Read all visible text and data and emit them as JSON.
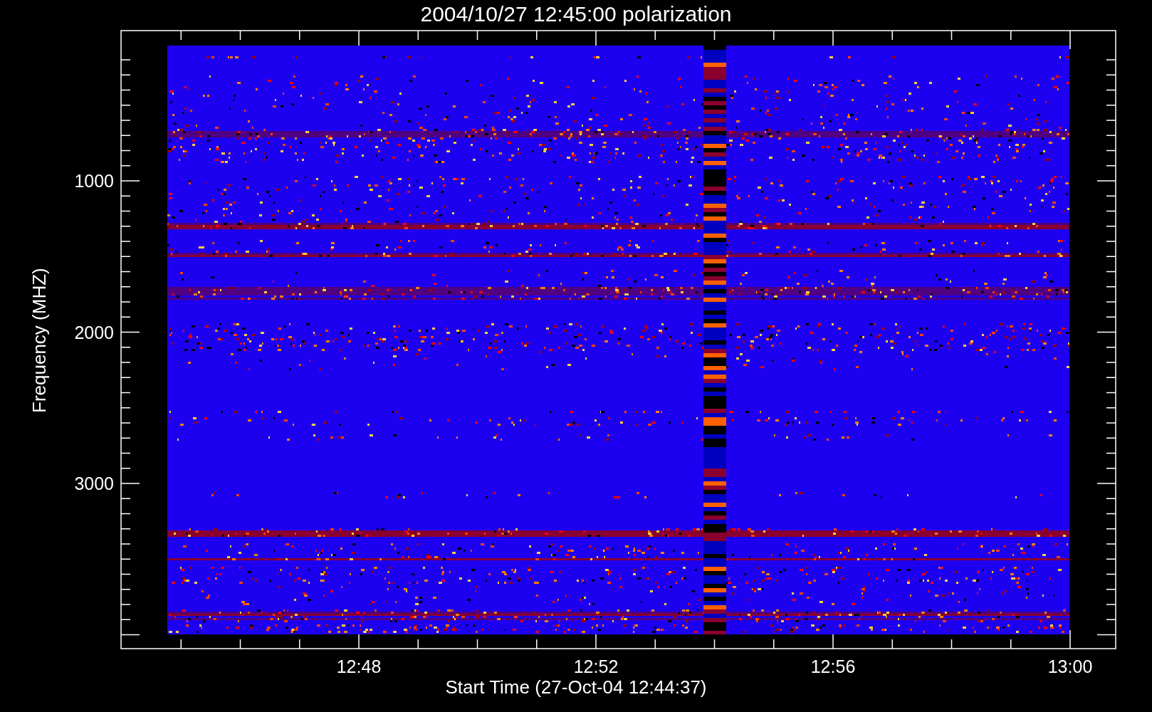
{
  "title": "2004/10/27 12:45:00 polarization",
  "y_axis": {
    "label": "Frequency (MHZ)",
    "ticks": [
      "1000",
      "2000",
      "3000"
    ]
  },
  "x_axis": {
    "label": "Start Time (27-Oct-04 12:44:37)",
    "ticks": [
      "12:48",
      "12:52",
      "12:56",
      "13:00"
    ]
  }
}
